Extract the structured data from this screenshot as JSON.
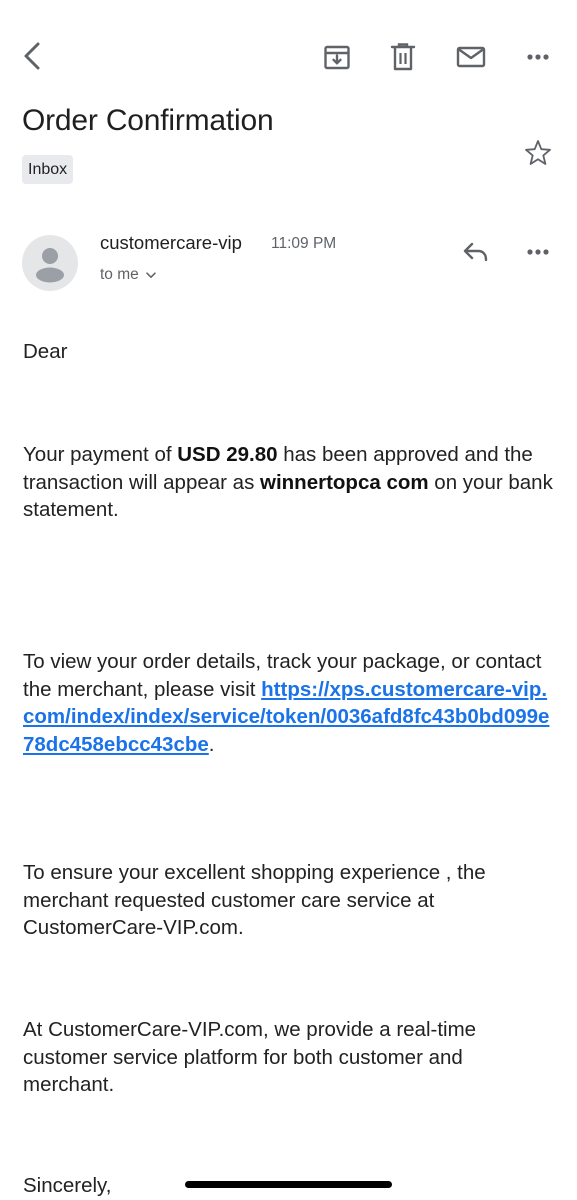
{
  "toolbar": {
    "back_icon": "chevron-left-icon",
    "archive_icon": "archive-icon",
    "delete_icon": "trash-icon",
    "mark_unread_icon": "envelope-icon",
    "more_icon": "more-horizontal-icon"
  },
  "email": {
    "subject": "Order Confirmation",
    "label": "Inbox",
    "sender": "customercare-vip",
    "time": "11:09 PM",
    "recipient": "to me",
    "greeting": "Dear",
    "p1": {
      "t1": "Your payment of ",
      "amount": "USD 29.80",
      "t2": " has been approved and the transaction will appear as  ",
      "merchant": "winnertopca com",
      "t3": " on your bank statement."
    },
    "p2": {
      "t1": "To view your order details, track your package, or contact the merchant, please visit ",
      "link": "https://xps.customercare-vip.com/index/index/service/token/0036afd8fc43b0bd099e78dc458ebcc43cbe",
      "t2": "."
    },
    "p3": "To ensure your excellent shopping experience , the merchant requested customer care service at CustomerCare-VIP.com.",
    "p4": "At CustomerCare-VIP.com, we provide a real-time customer service platform for both customer and merchant.",
    "closing": "Sincerely,"
  },
  "colors": {
    "link": "#1a73e8",
    "chip_bg": "#e8eaed",
    "icon": "#5f6368",
    "text": "#222222"
  }
}
